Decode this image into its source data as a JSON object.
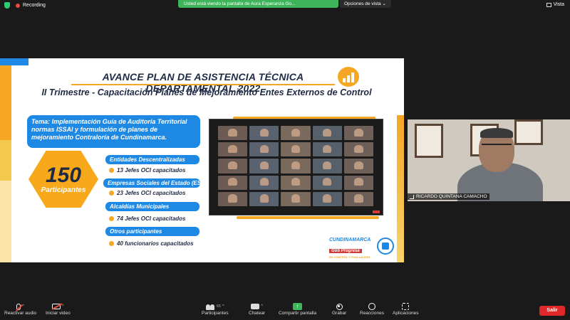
{
  "topbar": {
    "recording_label": "Recording",
    "share_banner": "Usted está viendo la pantalla de Aura Esperanza Go...",
    "view_options_label": "Opciones de vista",
    "view_label": "Vista"
  },
  "slide": {
    "title": "AVANCE PLAN DE ASISTENCIA TÉCNICA DEPARTAMENTAL 2022",
    "subtitle": "II Trimestre - Capacitación Planes de Mejoramiento Entes Externos de Control",
    "tema": "Tema: Implementación Guía de Auditoría Territorial normas ISSAI y formulación de planes de mejoramiento Contraloría de Cundinamarca.",
    "total_number": "150",
    "total_label": "Participantes",
    "categories": [
      {
        "label": "Entidades Descentralizadas",
        "detail": "13 Jefes OCI capacitados"
      },
      {
        "label": "Empresas Sociales del Estado (ESE's)",
        "detail": "23 Jefes OCI capacitados"
      },
      {
        "label": "Alcaldías Municipales",
        "detail": "74 Jefes OCI capacitados"
      },
      {
        "label": "Otros participantes",
        "detail": "40 funcionarios capacitados"
      }
    ],
    "logo": {
      "line1": "CUNDINAMARCA",
      "line2": "Gob Progresa",
      "line3": "EN CONTROL Y EVALUACIÓN"
    }
  },
  "participant_video": {
    "name": "RICARDO QUINTANA CAMACHO"
  },
  "toolbar": {
    "audio_label": "Reactivar audio",
    "video_label": "Iniciar video",
    "participants_label": "Participantes",
    "participants_count": "65",
    "chat_label": "Chatear",
    "share_label": "Compartir pantalla",
    "record_label": "Grabar",
    "reactions_label": "Reacciones",
    "apps_label": "Aplicaciones",
    "leave_label": "Salir"
  },
  "colors": {
    "accent_blue": "#1e88e5",
    "accent_orange": "#f5a623",
    "share_green": "#3fb55b",
    "leave_red": "#e02828"
  }
}
